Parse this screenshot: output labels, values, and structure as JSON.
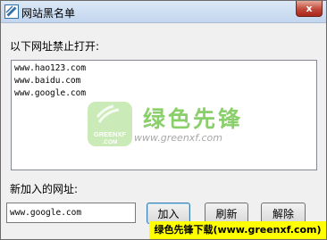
{
  "window": {
    "title": "网站黑名单",
    "close_glyph": "x",
    "app_icon": "blacklist-app-icon"
  },
  "blocked_section": {
    "label": "以下网址禁止打开:",
    "urls": [
      "www.hao123.com",
      "www.baidu.com",
      "www.google.com"
    ]
  },
  "watermark": {
    "logo_text": "GREENXF\n.COM",
    "title": "绿色先锋",
    "url": "www.greenxf.com"
  },
  "new_entry": {
    "label": "新加入的网址:",
    "value": "www.google.com"
  },
  "buttons": {
    "add": "加入",
    "refresh": "刷新",
    "remove": "解除"
  },
  "credit_banner": "绿色先锋下载(www.greenxf.com)",
  "colors": {
    "watermark_green": "#8ad06a",
    "banner_yellow": "#ffff00"
  }
}
